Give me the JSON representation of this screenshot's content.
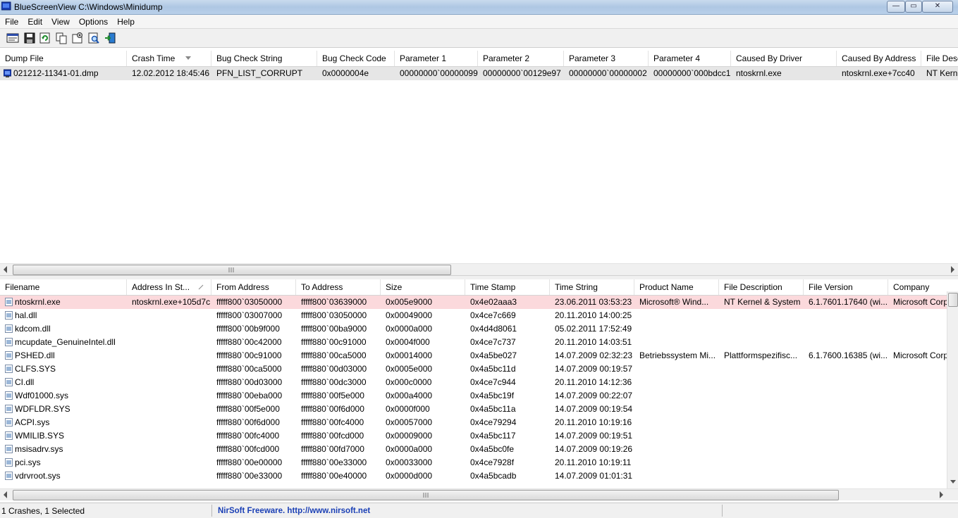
{
  "window": {
    "title": "BlueScreenView   C:\\Windows\\Minidump",
    "buttons": {
      "minimize": "—",
      "maximize": "▭",
      "close": "✕"
    }
  },
  "menu": [
    "File",
    "Edit",
    "View",
    "Options",
    "Help"
  ],
  "toolbar": [
    "options-icon",
    "save-icon",
    "refresh-icon",
    "copy-icon",
    "properties-icon",
    "find-icon",
    "exit-icon"
  ],
  "top_table": {
    "columns": [
      "Dump File",
      "Crash Time",
      "Bug Check String",
      "Bug Check Code",
      "Parameter 1",
      "Parameter 2",
      "Parameter 3",
      "Parameter 4",
      "Caused By Driver",
      "Caused By Address",
      "File Description"
    ],
    "rows": [
      [
        "021212-11341-01.dmp",
        "12.02.2012 18:45:46",
        "PFN_LIST_CORRUPT",
        "0x0000004e",
        "00000000`00000099",
        "00000000`00129e97",
        "00000000`00000002",
        "00000000`000bdcc1",
        "ntoskrnl.exe",
        "ntoskrnl.exe+7cc40",
        "NT Kernel"
      ]
    ]
  },
  "bottom_table": {
    "columns": [
      "Filename",
      "Address In St...",
      "From Address",
      "To Address",
      "Size",
      "Time Stamp",
      "Time String",
      "Product Name",
      "File Description",
      "File Version",
      "Company"
    ],
    "rows": [
      [
        "ntoskrnl.exe",
        "ntoskrnl.exe+105d7c",
        "fffff800`03050000",
        "fffff800`03639000",
        "0x005e9000",
        "0x4e02aaa3",
        "23.06.2011 03:53:23",
        "Microsoft® Wind...",
        "NT Kernel & System",
        "6.1.7601.17640 (wi...",
        "Microsoft Corp"
      ],
      [
        "hal.dll",
        "",
        "fffff800`03007000",
        "fffff800`03050000",
        "0x00049000",
        "0x4ce7c669",
        "20.11.2010 14:00:25",
        "",
        "",
        "",
        ""
      ],
      [
        "kdcom.dll",
        "",
        "fffff800`00b9f000",
        "fffff800`00ba9000",
        "0x0000a000",
        "0x4d4d8061",
        "05.02.2011 17:52:49",
        "",
        "",
        "",
        ""
      ],
      [
        "mcupdate_GenuineIntel.dll",
        "",
        "fffff880`00c42000",
        "fffff880`00c91000",
        "0x0004f000",
        "0x4ce7c737",
        "20.11.2010 14:03:51",
        "",
        "",
        "",
        ""
      ],
      [
        "PSHED.dll",
        "",
        "fffff880`00c91000",
        "fffff880`00ca5000",
        "0x00014000",
        "0x4a5be027",
        "14.07.2009 02:32:23",
        "Betriebssystem Mi...",
        "Plattformspezifisc...",
        "6.1.7600.16385 (wi...",
        "Microsoft Corp"
      ],
      [
        "CLFS.SYS",
        "",
        "fffff880`00ca5000",
        "fffff880`00d03000",
        "0x0005e000",
        "0x4a5bc11d",
        "14.07.2009 00:19:57",
        "",
        "",
        "",
        ""
      ],
      [
        "CI.dll",
        "",
        "fffff880`00d03000",
        "fffff880`00dc3000",
        "0x000c0000",
        "0x4ce7c944",
        "20.11.2010 14:12:36",
        "",
        "",
        "",
        ""
      ],
      [
        "Wdf01000.sys",
        "",
        "fffff880`00eba000",
        "fffff880`00f5e000",
        "0x000a4000",
        "0x4a5bc19f",
        "14.07.2009 00:22:07",
        "",
        "",
        "",
        ""
      ],
      [
        "WDFLDR.SYS",
        "",
        "fffff880`00f5e000",
        "fffff880`00f6d000",
        "0x0000f000",
        "0x4a5bc11a",
        "14.07.2009 00:19:54",
        "",
        "",
        "",
        ""
      ],
      [
        "ACPI.sys",
        "",
        "fffff880`00f6d000",
        "fffff880`00fc4000",
        "0x00057000",
        "0x4ce79294",
        "20.11.2010 10:19:16",
        "",
        "",
        "",
        ""
      ],
      [
        "WMILIB.SYS",
        "",
        "fffff880`00fc4000",
        "fffff880`00fcd000",
        "0x00009000",
        "0x4a5bc117",
        "14.07.2009 00:19:51",
        "",
        "",
        "",
        ""
      ],
      [
        "msisadrv.sys",
        "",
        "fffff880`00fcd000",
        "fffff880`00fd7000",
        "0x0000a000",
        "0x4a5bc0fe",
        "14.07.2009 00:19:26",
        "",
        "",
        "",
        ""
      ],
      [
        "pci.sys",
        "",
        "fffff880`00e00000",
        "fffff880`00e33000",
        "0x00033000",
        "0x4ce7928f",
        "20.11.2010 10:19:11",
        "",
        "",
        "",
        ""
      ],
      [
        "vdrvroot.sys",
        "",
        "fffff880`00e33000",
        "fffff880`00e40000",
        "0x0000d000",
        "0x4a5bcadb",
        "14.07.2009 01:01:31",
        "",
        "",
        "",
        ""
      ]
    ]
  },
  "status": {
    "summary": "1 Crashes, 1 Selected",
    "credit": "NirSoft Freeware.  http://www.nirsoft.net"
  },
  "colors": {
    "selected_row_top": "#e6e6e6",
    "selected_row_bottom": "#fbd9dc",
    "credit_link": "#1a3fb5"
  }
}
